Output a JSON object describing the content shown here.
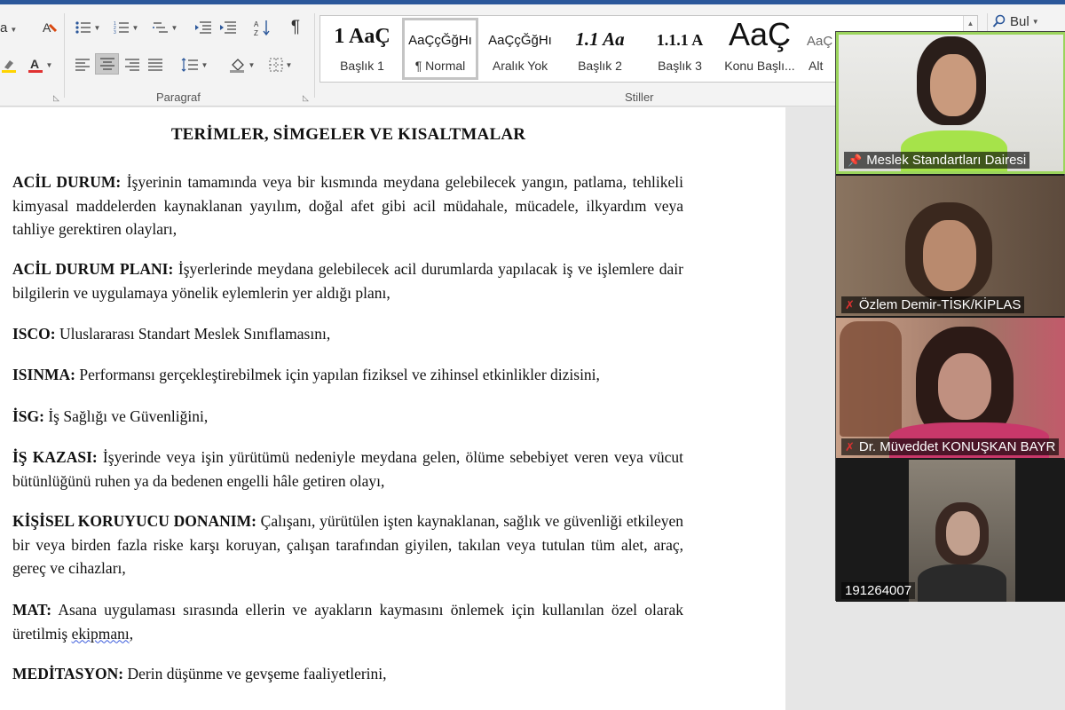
{
  "ribbon": {
    "top_left_glyph": "a",
    "search_label": "Bul",
    "groups": {
      "paragraph_label": "Paragraf",
      "styles_label": "Stiller"
    },
    "styles": [
      {
        "sample": "1  AaÇ",
        "name": "Başlık 1"
      },
      {
        "sample": "AaÇçĞğHı",
        "name": "¶ Normal"
      },
      {
        "sample": "AaÇçĞğHı",
        "name": "Aralık Yok"
      },
      {
        "sample": "1.1  Aa",
        "name": "Başlık 2"
      },
      {
        "sample": "1.1.1  A",
        "name": "Başlık 3"
      },
      {
        "sample": "AaÇ",
        "name": "Konu Başlı..."
      },
      {
        "sample": "AaÇ",
        "name": "Alt"
      }
    ]
  },
  "document": {
    "title": "TERİMLER, SİMGELER VE KISALTMALAR",
    "entries": [
      {
        "term": "ACİL DURUM:",
        "text": " İşyerinin tamamında veya bir kısmında meydana gelebilecek yangın, patlama, tehlikeli kimyasal maddelerden kaynaklanan yayılım, doğal afet gibi acil müdahale, mücadele, ilkyardım veya tahliye gerektiren olayları,"
      },
      {
        "term": "ACİL DURUM PLANI:",
        "text": " İşyerlerinde meydana gelebilecek acil durumlarda yapılacak iş ve işlemlere dair bilgilerin ve uygulamaya yönelik eylemlerin yer aldığı planı,"
      },
      {
        "term": "ISCO:",
        "text": " Uluslararası Standart Meslek Sınıflamasını,"
      },
      {
        "term": "ISINMA:",
        "text": " Performansı gerçekleştirebilmek için yapılan fiziksel ve zihinsel etkinlikler dizisini,"
      },
      {
        "term": "İSG:",
        "text": " İş Sağlığı ve Güvenliğini,"
      },
      {
        "term": "İŞ KAZASI:",
        "text": " İşyerinde veya işin yürütümü nedeniyle meydana gelen, ölüme sebebiyet veren veya vücut bütünlüğünü ruhen ya da bedenen engelli hâle getiren olayı,"
      },
      {
        "term": "KİŞİSEL KORUYUCU DONANIM:",
        "text": " Çalışanı, yürütülen işten kaynaklanan, sağlık ve güvenliği etkileyen bir veya birden fazla riske karşı koruyan, çalışan tarafından giyilen, takılan veya tutulan tüm alet, araç, gereç ve cihazları,"
      },
      {
        "term": "MAT:",
        "text": " Asana uygulaması sırasında ellerin ve ayakların kaymasını önlemek için kullanılan özel olarak üretilmiş ",
        "flagged": "ekipmanı",
        "tail": ","
      },
      {
        "term": "MEDİTASYON:",
        "text": " Derin düşünme ve gevşeme faaliyetlerini,"
      }
    ]
  },
  "participants": [
    {
      "name": "Meslek Standartları Dairesi",
      "status_icon": "pin-icon",
      "muted": false,
      "active": true
    },
    {
      "name": "Özlem Demir-TİSK/KİPLAS",
      "status_icon": "mic-muted-icon",
      "muted": true,
      "active": false
    },
    {
      "name": "Dr. Müveddet KONUŞKAN BAYR",
      "status_icon": "mic-muted-icon",
      "muted": true,
      "active": false
    },
    {
      "name": "191264007",
      "status_icon": "",
      "muted": false,
      "active": false
    }
  ],
  "colors": {
    "accent": "#2b579a",
    "active_speaker": "#9bd45c",
    "muted": "#e03131"
  }
}
